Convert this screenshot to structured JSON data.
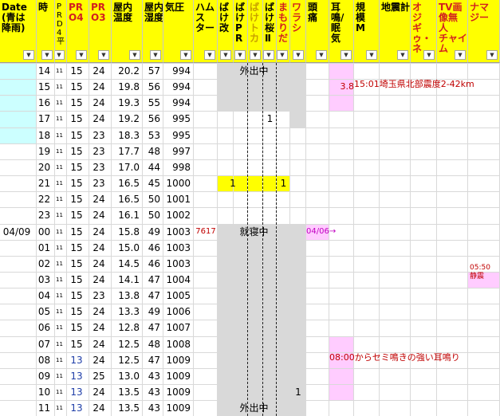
{
  "headers": [
    {
      "key": "date",
      "label": "Date\n(青は\n降雨)",
      "color": "#000000"
    },
    {
      "key": "hour",
      "label": "時",
      "color": "#000000"
    },
    {
      "key": "prd",
      "label": "P\nR\nD\n4\n平",
      "color": "#000000"
    },
    {
      "key": "pr04",
      "label": "PR\nO4",
      "color": "#d21f1f"
    },
    {
      "key": "pr03",
      "label": "PR\nO3",
      "color": "#d21f1f"
    },
    {
      "key": "temp",
      "label": "屋内\n温度",
      "color": "#000000"
    },
    {
      "key": "humid",
      "label": "屋内\n湿度",
      "color": "#000000"
    },
    {
      "key": "press",
      "label": "気圧",
      "color": "#000000"
    },
    {
      "key": "hamster",
      "label": "ハム\nス\nター",
      "color": "#000000"
    },
    {
      "key": "bake1",
      "label": "ば\nけ\n改",
      "color": "#000000"
    },
    {
      "key": "bake2",
      "label": "ば\nけ\nP\nR",
      "color": "#000000"
    },
    {
      "key": "bake3",
      "label": "ば\nけ\nト\nカ",
      "color": "#c8a000"
    },
    {
      "key": "bake4",
      "label": "ば\nけ\n桜\nⅡ",
      "color": "#000000"
    },
    {
      "key": "mamori",
      "label": "ま\nも\nり\nだ",
      "color": "#d21f1f"
    },
    {
      "key": "warashi",
      "label": "ワ\nラ\nシ",
      "color": "#d21f1f"
    },
    {
      "key": "zutsu",
      "label": "頭\n痛",
      "color": "#000000"
    },
    {
      "key": "mimi",
      "label": "耳\n鳴/\n眠\n気",
      "color": "#000000"
    },
    {
      "key": "scale",
      "label": "規\n模\nM",
      "color": "#000000"
    },
    {
      "key": "quake",
      "label": "地震計",
      "color": "#000000"
    },
    {
      "key": "ojigi",
      "label": "オ\nジ\nギ\nゥ・\nネ",
      "color": "#d21f1f"
    },
    {
      "key": "tv",
      "label": "TV画\n像無\n人\nチャイ\nム",
      "color": "#d21f1f"
    },
    {
      "key": "namaji",
      "label": "ナマ\nジー",
      "color": "#d21f1f"
    }
  ],
  "dropdown_glyph": "▼",
  "rows": [
    {
      "date": "",
      "hour": "14",
      "prd": "11",
      "pr04": "15",
      "pr03": "24",
      "temp": "20.2",
      "humid": "57",
      "press": "994"
    },
    {
      "date": "",
      "hour": "15",
      "prd": "11",
      "pr04": "15",
      "pr03": "24",
      "temp": "19.8",
      "humid": "56",
      "press": "994"
    },
    {
      "date": "",
      "hour": "16",
      "prd": "11",
      "pr04": "15",
      "pr03": "24",
      "temp": "19.3",
      "humid": "55",
      "press": "994"
    },
    {
      "date": "",
      "hour": "17",
      "prd": "11",
      "pr04": "15",
      "pr03": "24",
      "temp": "19.2",
      "humid": "56",
      "press": "995"
    },
    {
      "date": "",
      "hour": "18",
      "prd": "11",
      "pr04": "15",
      "pr03": "23",
      "temp": "18.3",
      "humid": "53",
      "press": "995"
    },
    {
      "date": "",
      "hour": "19",
      "prd": "11",
      "pr04": "15",
      "pr03": "23",
      "temp": "17.7",
      "humid": "48",
      "press": "997"
    },
    {
      "date": "",
      "hour": "20",
      "prd": "11",
      "pr04": "15",
      "pr03": "23",
      "temp": "17.0",
      "humid": "44",
      "press": "998"
    },
    {
      "date": "",
      "hour": "21",
      "prd": "11",
      "pr04": "15",
      "pr03": "23",
      "temp": "16.5",
      "humid": "45",
      "press": "1000"
    },
    {
      "date": "",
      "hour": "22",
      "prd": "11",
      "pr04": "15",
      "pr03": "24",
      "temp": "16.5",
      "humid": "50",
      "press": "1001"
    },
    {
      "date": "",
      "hour": "23",
      "prd": "11",
      "pr04": "15",
      "pr03": "24",
      "temp": "16.1",
      "humid": "50",
      "press": "1002"
    },
    {
      "date": "04/09",
      "hour": "00",
      "prd": "11",
      "pr04": "15",
      "pr03": "24",
      "temp": "15.8",
      "humid": "49",
      "press": "1003"
    },
    {
      "date": "",
      "hour": "01",
      "prd": "11",
      "pr04": "15",
      "pr03": "24",
      "temp": "15.0",
      "humid": "46",
      "press": "1003"
    },
    {
      "date": "",
      "hour": "02",
      "prd": "11",
      "pr04": "15",
      "pr03": "24",
      "temp": "14.5",
      "humid": "46",
      "press": "1003"
    },
    {
      "date": "",
      "hour": "03",
      "prd": "11",
      "pr04": "15",
      "pr03": "24",
      "temp": "14.1",
      "humid": "47",
      "press": "1004"
    },
    {
      "date": "",
      "hour": "04",
      "prd": "11",
      "pr04": "15",
      "pr03": "23",
      "temp": "13.8",
      "humid": "47",
      "press": "1005"
    },
    {
      "date": "",
      "hour": "05",
      "prd": "11",
      "pr04": "15",
      "pr03": "24",
      "temp": "13.3",
      "humid": "49",
      "press": "1006"
    },
    {
      "date": "",
      "hour": "06",
      "prd": "11",
      "pr04": "15",
      "pr03": "24",
      "temp": "12.8",
      "humid": "47",
      "press": "1007"
    },
    {
      "date": "",
      "hour": "07",
      "prd": "11",
      "pr04": "15",
      "pr03": "24",
      "temp": "12.5",
      "humid": "48",
      "press": "1008"
    },
    {
      "date": "",
      "hour": "08",
      "prd": "11",
      "pr04": "13",
      "pr03": "24",
      "temp": "12.5",
      "humid": "47",
      "press": "1009"
    },
    {
      "date": "",
      "hour": "09",
      "prd": "11",
      "pr04": "13",
      "pr03": "25",
      "temp": "13.0",
      "humid": "43",
      "press": "1009"
    },
    {
      "date": "",
      "hour": "10",
      "prd": "11",
      "pr04": "13",
      "pr03": "24",
      "temp": "13.5",
      "humid": "43",
      "press": "1009"
    },
    {
      "date": "",
      "hour": "11",
      "prd": "11",
      "pr04": "13",
      "pr03": "24",
      "temp": "13.5",
      "humid": "43",
      "press": "1009"
    }
  ],
  "notes": {
    "out1": "外出中",
    "out2": "外出中",
    "sleep": "就寝中",
    "bake_pr_1": "1",
    "bake_pr_21": "1",
    "mamori_21": "1",
    "warashi_10": "1",
    "hamster_00": "7617",
    "zutsu_00": "04/06→",
    "scale_15": "3.8",
    "quake_15": "15:01埼玉県北部震度2-42km",
    "mimi_08": "08:00からセミ鳴きの強い耳鳴り",
    "namaji_03": "05:50\n静震"
  },
  "colors": {
    "header_bg": "#ffff00",
    "rain": "#ccffff",
    "gray": "#d9d9d9",
    "pink": "#ffccff",
    "yellow": "#ffff00",
    "blue_text": "#1f3ea8",
    "red_text": "#d21f1f"
  }
}
